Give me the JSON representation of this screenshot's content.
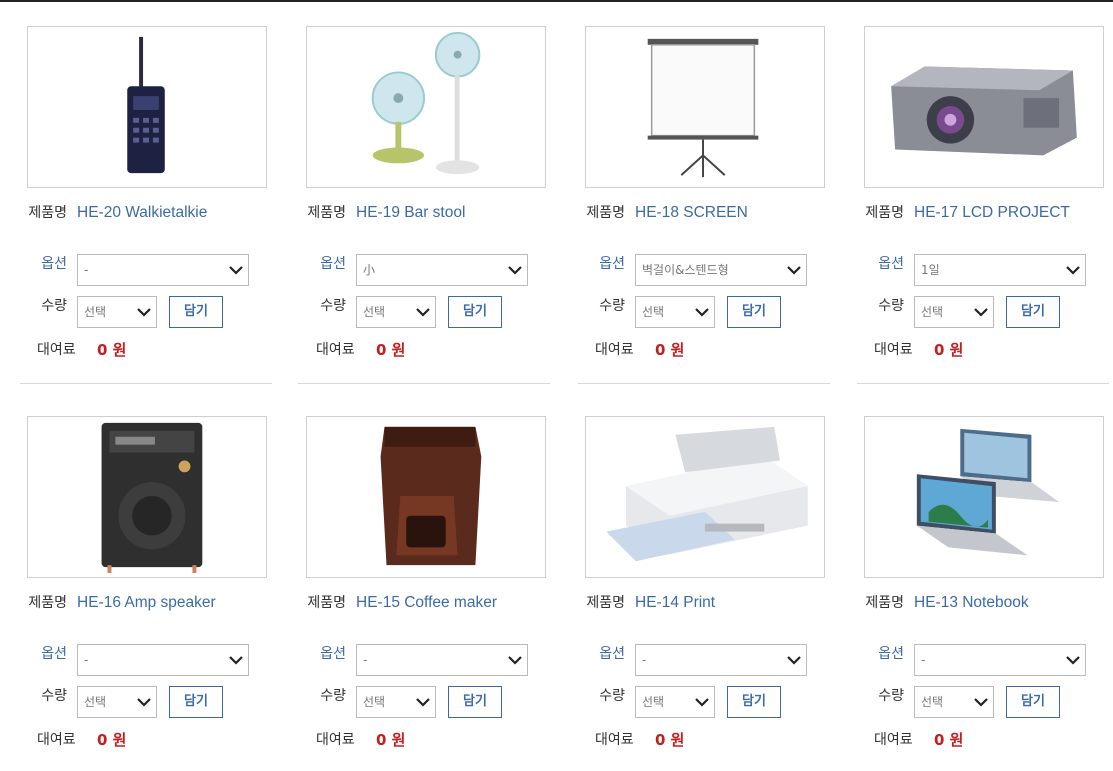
{
  "labels": {
    "name": "제품명",
    "option": "옵션",
    "qty": "수량",
    "rent": "대여료",
    "cart": "담기",
    "qty_default": "선택"
  },
  "products": [
    {
      "name": "HE-20 Walkietalkie",
      "option": "-",
      "price": "0 원",
      "image": "walkie-talkie"
    },
    {
      "name": "HE-19 Bar stool",
      "option": "小",
      "price": "0 원",
      "image": "electric-fan"
    },
    {
      "name": "HE-18 SCREEN",
      "option": "벽걸이&스텐드형",
      "price": "0 원",
      "image": "projection-screen"
    },
    {
      "name": "HE-17 LCD PROJECT",
      "option": "1일",
      "price": "0 원",
      "image": "lcd-projector"
    },
    {
      "name": "HE-16 Amp speaker",
      "option": "-",
      "price": "0 원",
      "image": "amp-speaker"
    },
    {
      "name": "HE-15 Coffee maker",
      "option": "-",
      "price": "0 원",
      "image": "coffee-maker"
    },
    {
      "name": "HE-14 Print",
      "option": "-",
      "price": "0 원",
      "image": "laser-printer"
    },
    {
      "name": "HE-13 Notebook",
      "option": "-",
      "price": "0 원",
      "image": "notebook"
    }
  ],
  "colors": {
    "link": "#3b6aa6",
    "price": "#c41f1f"
  }
}
